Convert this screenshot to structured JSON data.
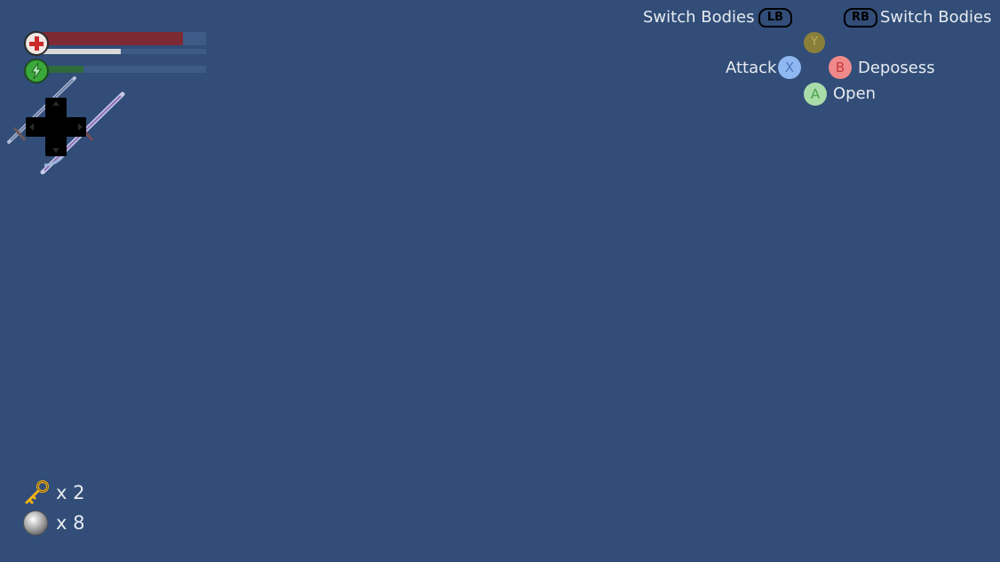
{
  "hud": {
    "health": {
      "fill_fraction": 0.86,
      "sub_fraction": 0.48,
      "color": "#7e2a35",
      "icon": "health-cross-icon"
    },
    "energy": {
      "fill_fraction": 0.25,
      "color": "#2f6a3a",
      "icon": "lightning-icon"
    },
    "weapon": {
      "icon": "crossed-swords-icon",
      "dpad_icon": "dpad-icon"
    }
  },
  "controls": {
    "lb": {
      "button": "LB",
      "label": "Switch Bodies"
    },
    "rb": {
      "button": "RB",
      "label": "Switch Bodies"
    },
    "y": {
      "button": "Y",
      "label": "",
      "color": "#8a7f3a"
    },
    "x": {
      "button": "X",
      "label": "Attack",
      "color": "#8fb8f0"
    },
    "b": {
      "button": "B",
      "label": "Deposess",
      "color": "#f08a8a"
    },
    "a": {
      "button": "A",
      "label": "Open",
      "color": "#a9dca9"
    }
  },
  "inventory": {
    "keys": {
      "icon": "key-icon",
      "count": "x 2"
    },
    "orbs": {
      "icon": "orb-icon",
      "count": "x 8"
    }
  }
}
